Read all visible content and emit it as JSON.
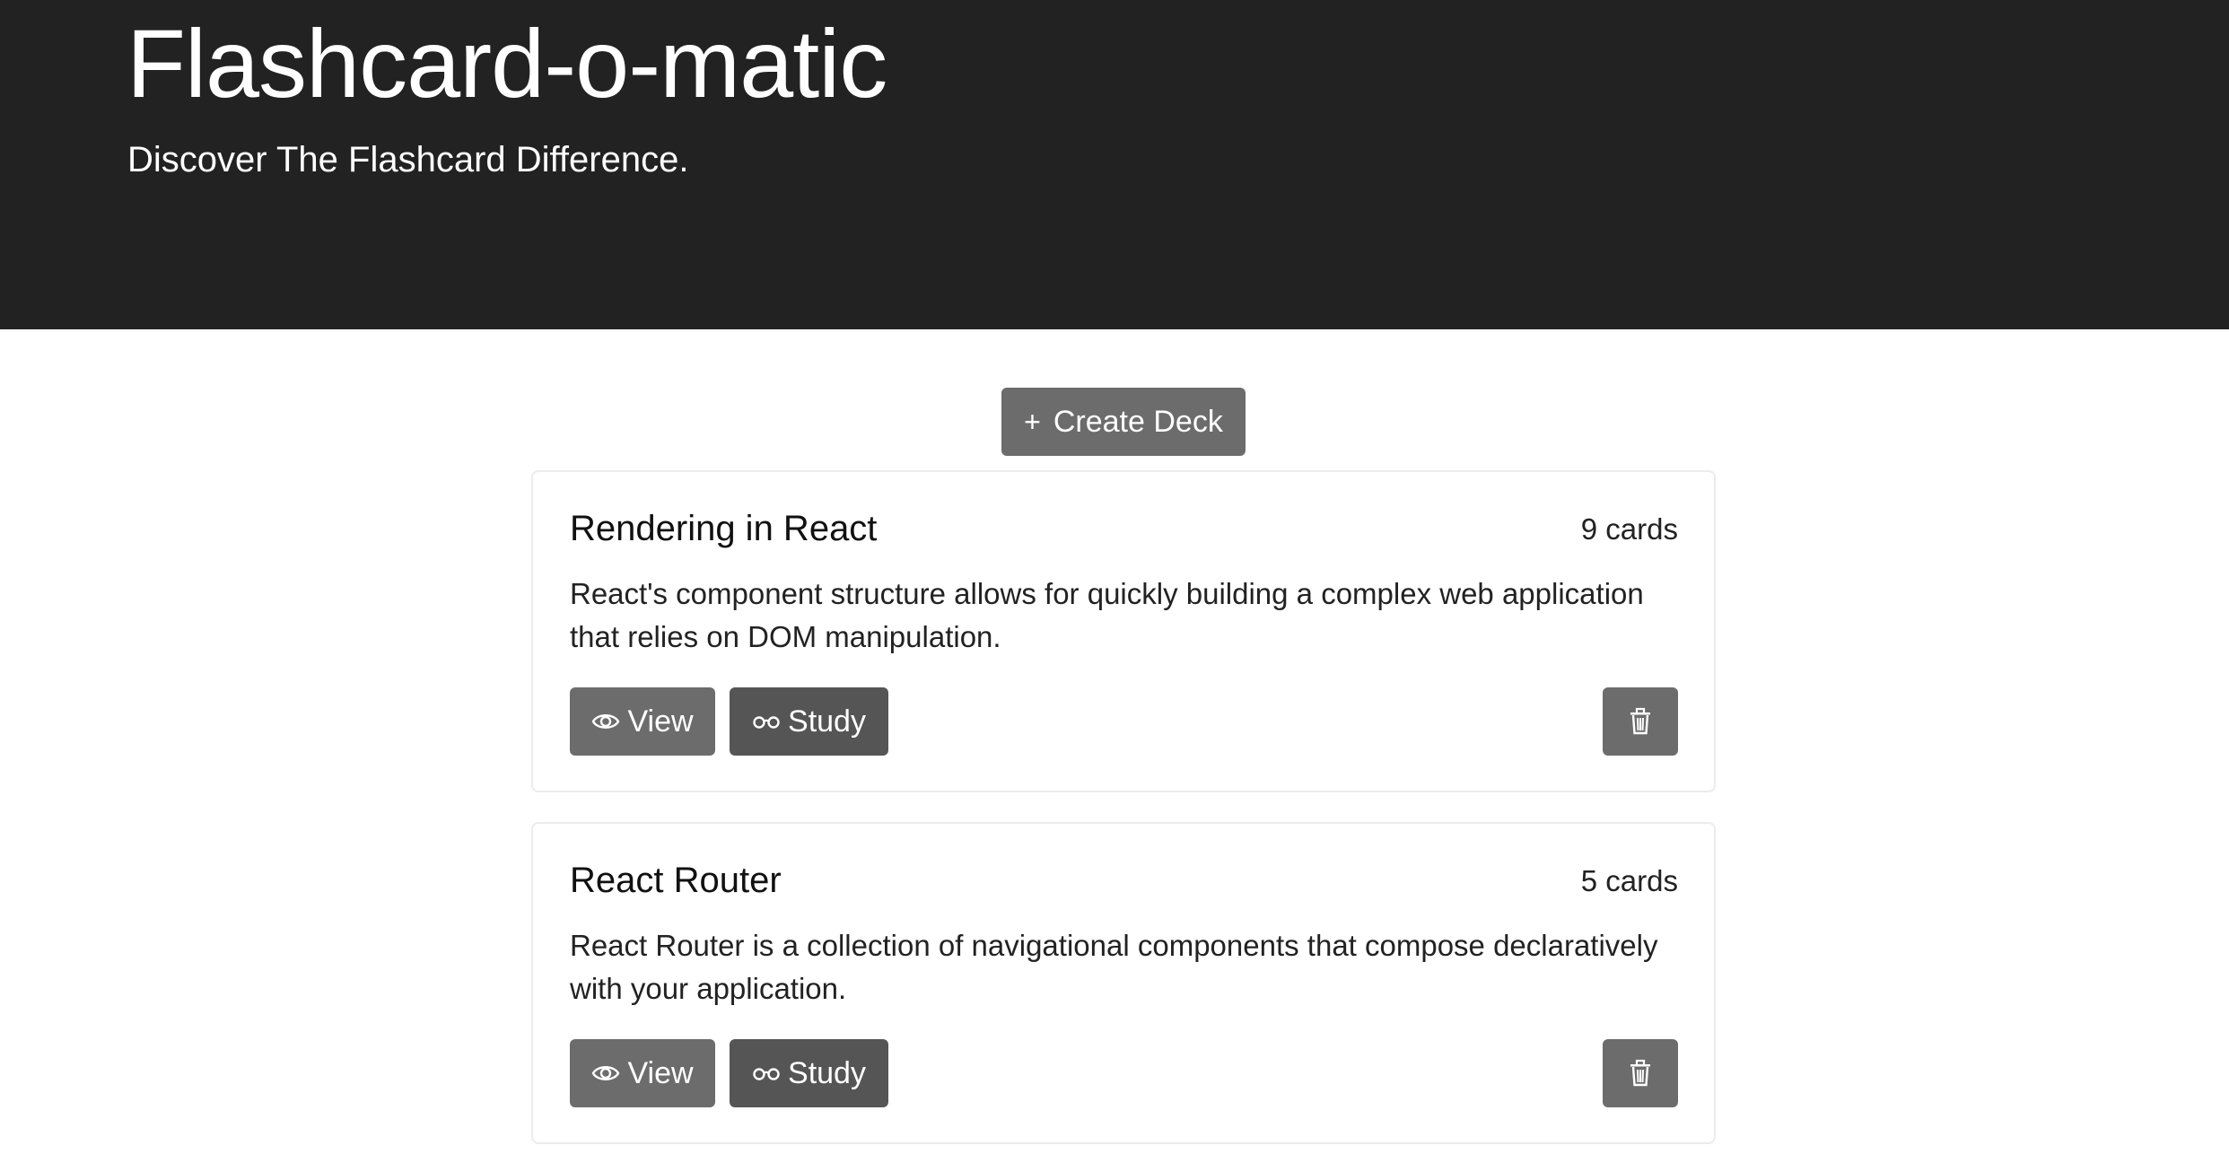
{
  "header": {
    "title": "Flashcard-o-matic",
    "subtitle": "Discover The Flashcard Difference."
  },
  "actions": {
    "create_icon": "plus-icon",
    "create_label": "Create Deck"
  },
  "decks": [
    {
      "name": "Rendering in React",
      "count": "9 cards",
      "description": "React's component structure allows for quickly building a complex web application that relies on DOM manipulation.",
      "view_label": "View",
      "study_label": "Study"
    },
    {
      "name": "React Router",
      "count": "5 cards",
      "description": "React Router is a collection of navigational components that compose declaratively with your application.",
      "view_label": "View",
      "study_label": "Study"
    }
  ],
  "icons": {
    "view": "eye-icon",
    "study": "glasses-icon",
    "delete": "trash-icon",
    "create": "plus-icon"
  },
  "colors": {
    "hero_background": "#222222",
    "hero_text": "#ffffff",
    "button_secondary": "#6c6c6c",
    "button_dark": "#555555",
    "card_border": "#ececec"
  }
}
